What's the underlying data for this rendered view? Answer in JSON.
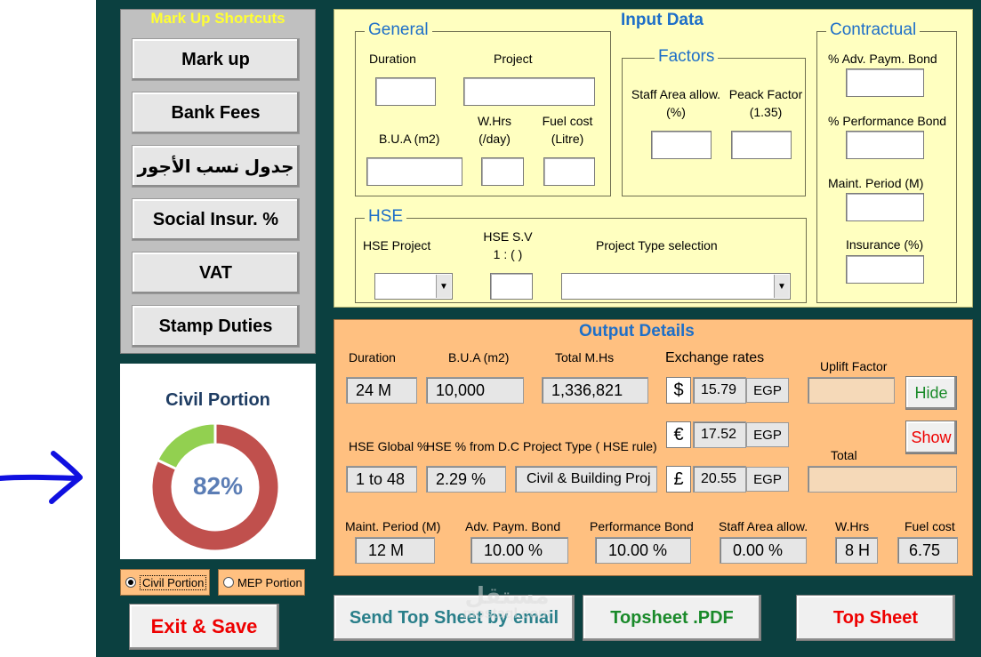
{
  "shortcuts": {
    "title": "Mark Up Shortcuts",
    "buttons": [
      "Mark up",
      "Bank Fees",
      "جدول نسب الأجور",
      "Social Insur. %",
      "VAT",
      "Stamp Duties"
    ]
  },
  "chart_data": {
    "type": "pie",
    "title": "Civil Portion",
    "center_label": "82%",
    "slices": [
      {
        "value": 82,
        "color": "#c0504d"
      },
      {
        "value": 18,
        "color": "#92d050"
      }
    ]
  },
  "radios": {
    "civil": "Civil Portion",
    "mep": "MEP Portion",
    "selected": "civil"
  },
  "input": {
    "title": "Input Data",
    "general": {
      "legend": "General",
      "duration": "Duration",
      "project": "Project",
      "bua": "B.U.A (m2)",
      "whrs_line1": "W.Hrs",
      "whrs_line2": "(/day)",
      "fuel_line1": "Fuel cost",
      "fuel_line2": "(Litre)"
    },
    "factors": {
      "legend": "Factors",
      "staff_line1": "Staff Area allow.",
      "staff_line2": "(%)",
      "peack_line1": "Peack Factor",
      "peack_line2": "(1.35)"
    },
    "contractual": {
      "legend": "Contractual",
      "adv": "% Adv. Paym. Bond",
      "perf": "% Performance Bond",
      "maint": "Maint. Period (M)",
      "insur": "Insurance (%)"
    },
    "hse": {
      "legend": "HSE",
      "project": "HSE Project",
      "sv_line1": "HSE S.V",
      "sv_line2": "1 : (  )",
      "type": "Project Type selection"
    }
  },
  "output": {
    "title": "Output  Details",
    "labels": {
      "duration": "Duration",
      "bua": "B.U.A (m2)",
      "total_mhs": "Total  M.Hs",
      "exchange": "Exchange  rates",
      "uplift": "Uplift Factor",
      "hse_global": "HSE Global %",
      "hse_dc": "HSE % from D.C",
      "proj_type": "Project Type ( HSE rule)",
      "total": "Total",
      "maint": "Maint. Period (M)",
      "adv": "Adv. Paym. Bond",
      "perf": "Performance Bond",
      "staff": "Staff Area allow.",
      "whrs": "W.Hrs",
      "fuel": "Fuel cost"
    },
    "values": {
      "duration": "24  M",
      "bua": "10,000",
      "total_mhs": "1,336,821",
      "hse_global": "1 to 48",
      "hse_dc": "2.29 %",
      "proj_type": "Civil & Building Proj",
      "maint": "12  M",
      "adv": "10.00 %",
      "perf": "10.00 %",
      "staff": "0.00 %",
      "whrs": "8 H",
      "fuel": "6.75"
    },
    "rates": [
      {
        "symbol": "$",
        "value": "15.79",
        "unit": "EGP"
      },
      {
        "symbol": "€",
        "value": "17.52",
        "unit": "EGP"
      },
      {
        "symbol": "£",
        "value": "20.55",
        "unit": "EGP"
      }
    ],
    "hide": "Hide",
    "show": "Show"
  },
  "bottom": {
    "exit": "Exit & Save",
    "email": "Send Top Sheet by email",
    "pdf": "Topsheet .PDF",
    "top": "Top Sheet"
  },
  "watermark": {
    "main": "مستقل",
    "sub": "mostaql.com"
  },
  "colors": {
    "background": "#0b4040",
    "input_panel": "#ffffc0",
    "output_panel": "#ffc080",
    "title_blue": "#1e6fc8",
    "arrow_blue": "#1010e0"
  }
}
